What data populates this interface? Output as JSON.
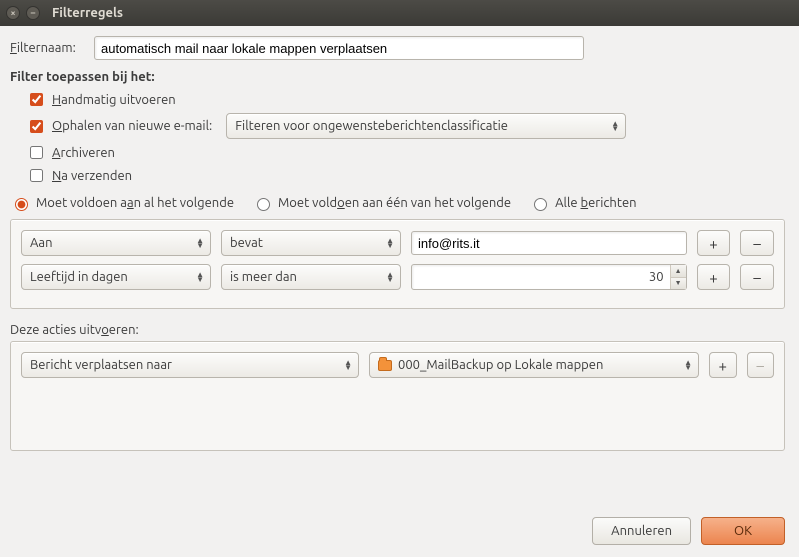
{
  "window": {
    "title": "Filterregels"
  },
  "filtername": {
    "label": "F",
    "label_rest": "ilternaam:",
    "value": "automatisch mail naar lokale mappen verplaatsen"
  },
  "apply_section": {
    "title": "Filter toepassen bij het:",
    "manual": {
      "checked": true,
      "pre": "H",
      "rest": "andmatig uitvoeren"
    },
    "fetch": {
      "checked": true,
      "pre": "O",
      "rest": "phalen van nieuwe e-mail:",
      "combo": "Filteren voor ongewensteberichtenclassificatie"
    },
    "archive": {
      "checked": false,
      "pre": "A",
      "rest": "rchiveren"
    },
    "aftersend": {
      "checked": false,
      "pre": "N",
      "rest": "a verzenden"
    }
  },
  "match": {
    "all": {
      "selected": true,
      "t1": "Moet voldoen a",
      "u": "a",
      "t2": "n al het volgende"
    },
    "any": {
      "selected": false,
      "t1": "Moet vold",
      "u": "o",
      "t2": "en aan één van het volgende"
    },
    "every": {
      "selected": false,
      "t1": "Alle ",
      "u": "b",
      "t2": "erichten"
    }
  },
  "conditions": [
    {
      "field": "Aan",
      "op": "bevat",
      "value": "info@rits.it",
      "numeric": false
    },
    {
      "field": "Leeftijd in dagen",
      "op": "is meer dan",
      "value": "30",
      "numeric": true
    }
  ],
  "actions_label": "Deze acties uitv",
  "actions_label_u": "o",
  "actions_label_rest": "eren:",
  "actions": [
    {
      "action": "Bericht verplaatsen naar",
      "target": "000_MailBackup op Lokale mappen",
      "removeDisabled": true
    }
  ],
  "footer": {
    "cancel": "Annuleren",
    "ok": "OK"
  }
}
